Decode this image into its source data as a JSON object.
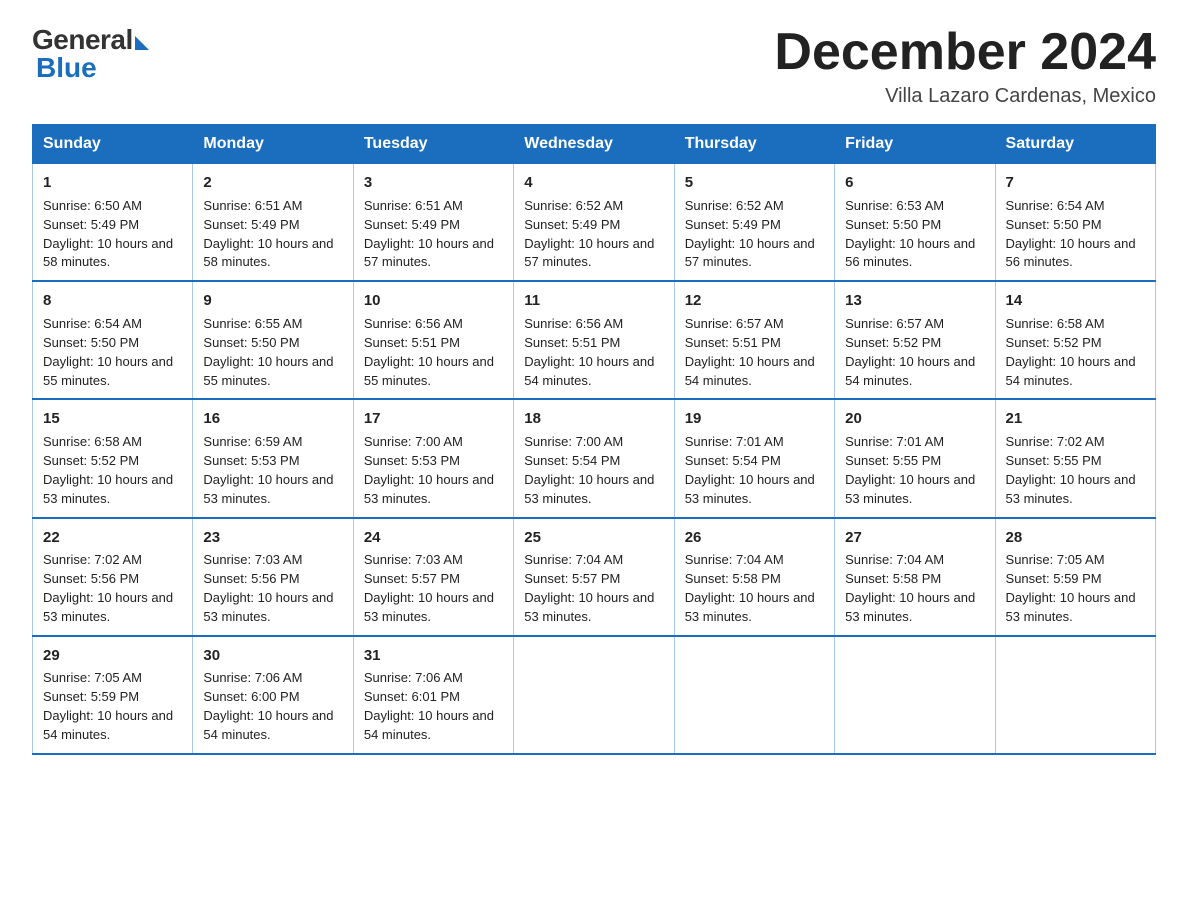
{
  "logo": {
    "general": "General",
    "blue": "Blue"
  },
  "title": "December 2024",
  "location": "Villa Lazaro Cardenas, Mexico",
  "days_header": [
    "Sunday",
    "Monday",
    "Tuesday",
    "Wednesday",
    "Thursday",
    "Friday",
    "Saturday"
  ],
  "weeks": [
    [
      {
        "day": "1",
        "sunrise": "6:50 AM",
        "sunset": "5:49 PM",
        "daylight": "10 hours and 58 minutes."
      },
      {
        "day": "2",
        "sunrise": "6:51 AM",
        "sunset": "5:49 PM",
        "daylight": "10 hours and 58 minutes."
      },
      {
        "day": "3",
        "sunrise": "6:51 AM",
        "sunset": "5:49 PM",
        "daylight": "10 hours and 57 minutes."
      },
      {
        "day": "4",
        "sunrise": "6:52 AM",
        "sunset": "5:49 PM",
        "daylight": "10 hours and 57 minutes."
      },
      {
        "day": "5",
        "sunrise": "6:52 AM",
        "sunset": "5:49 PM",
        "daylight": "10 hours and 57 minutes."
      },
      {
        "day": "6",
        "sunrise": "6:53 AM",
        "sunset": "5:50 PM",
        "daylight": "10 hours and 56 minutes."
      },
      {
        "day": "7",
        "sunrise": "6:54 AM",
        "sunset": "5:50 PM",
        "daylight": "10 hours and 56 minutes."
      }
    ],
    [
      {
        "day": "8",
        "sunrise": "6:54 AM",
        "sunset": "5:50 PM",
        "daylight": "10 hours and 55 minutes."
      },
      {
        "day": "9",
        "sunrise": "6:55 AM",
        "sunset": "5:50 PM",
        "daylight": "10 hours and 55 minutes."
      },
      {
        "day": "10",
        "sunrise": "6:56 AM",
        "sunset": "5:51 PM",
        "daylight": "10 hours and 55 minutes."
      },
      {
        "day": "11",
        "sunrise": "6:56 AM",
        "sunset": "5:51 PM",
        "daylight": "10 hours and 54 minutes."
      },
      {
        "day": "12",
        "sunrise": "6:57 AM",
        "sunset": "5:51 PM",
        "daylight": "10 hours and 54 minutes."
      },
      {
        "day": "13",
        "sunrise": "6:57 AM",
        "sunset": "5:52 PM",
        "daylight": "10 hours and 54 minutes."
      },
      {
        "day": "14",
        "sunrise": "6:58 AM",
        "sunset": "5:52 PM",
        "daylight": "10 hours and 54 minutes."
      }
    ],
    [
      {
        "day": "15",
        "sunrise": "6:58 AM",
        "sunset": "5:52 PM",
        "daylight": "10 hours and 53 minutes."
      },
      {
        "day": "16",
        "sunrise": "6:59 AM",
        "sunset": "5:53 PM",
        "daylight": "10 hours and 53 minutes."
      },
      {
        "day": "17",
        "sunrise": "7:00 AM",
        "sunset": "5:53 PM",
        "daylight": "10 hours and 53 minutes."
      },
      {
        "day": "18",
        "sunrise": "7:00 AM",
        "sunset": "5:54 PM",
        "daylight": "10 hours and 53 minutes."
      },
      {
        "day": "19",
        "sunrise": "7:01 AM",
        "sunset": "5:54 PM",
        "daylight": "10 hours and 53 minutes."
      },
      {
        "day": "20",
        "sunrise": "7:01 AM",
        "sunset": "5:55 PM",
        "daylight": "10 hours and 53 minutes."
      },
      {
        "day": "21",
        "sunrise": "7:02 AM",
        "sunset": "5:55 PM",
        "daylight": "10 hours and 53 minutes."
      }
    ],
    [
      {
        "day": "22",
        "sunrise": "7:02 AM",
        "sunset": "5:56 PM",
        "daylight": "10 hours and 53 minutes."
      },
      {
        "day": "23",
        "sunrise": "7:03 AM",
        "sunset": "5:56 PM",
        "daylight": "10 hours and 53 minutes."
      },
      {
        "day": "24",
        "sunrise": "7:03 AM",
        "sunset": "5:57 PM",
        "daylight": "10 hours and 53 minutes."
      },
      {
        "day": "25",
        "sunrise": "7:04 AM",
        "sunset": "5:57 PM",
        "daylight": "10 hours and 53 minutes."
      },
      {
        "day": "26",
        "sunrise": "7:04 AM",
        "sunset": "5:58 PM",
        "daylight": "10 hours and 53 minutes."
      },
      {
        "day": "27",
        "sunrise": "7:04 AM",
        "sunset": "5:58 PM",
        "daylight": "10 hours and 53 minutes."
      },
      {
        "day": "28",
        "sunrise": "7:05 AM",
        "sunset": "5:59 PM",
        "daylight": "10 hours and 53 minutes."
      }
    ],
    [
      {
        "day": "29",
        "sunrise": "7:05 AM",
        "sunset": "5:59 PM",
        "daylight": "10 hours and 54 minutes."
      },
      {
        "day": "30",
        "sunrise": "7:06 AM",
        "sunset": "6:00 PM",
        "daylight": "10 hours and 54 minutes."
      },
      {
        "day": "31",
        "sunrise": "7:06 AM",
        "sunset": "6:01 PM",
        "daylight": "10 hours and 54 minutes."
      },
      null,
      null,
      null,
      null
    ]
  ],
  "labels": {
    "sunrise_prefix": "Sunrise: ",
    "sunset_prefix": "Sunset: ",
    "daylight_prefix": "Daylight: "
  }
}
